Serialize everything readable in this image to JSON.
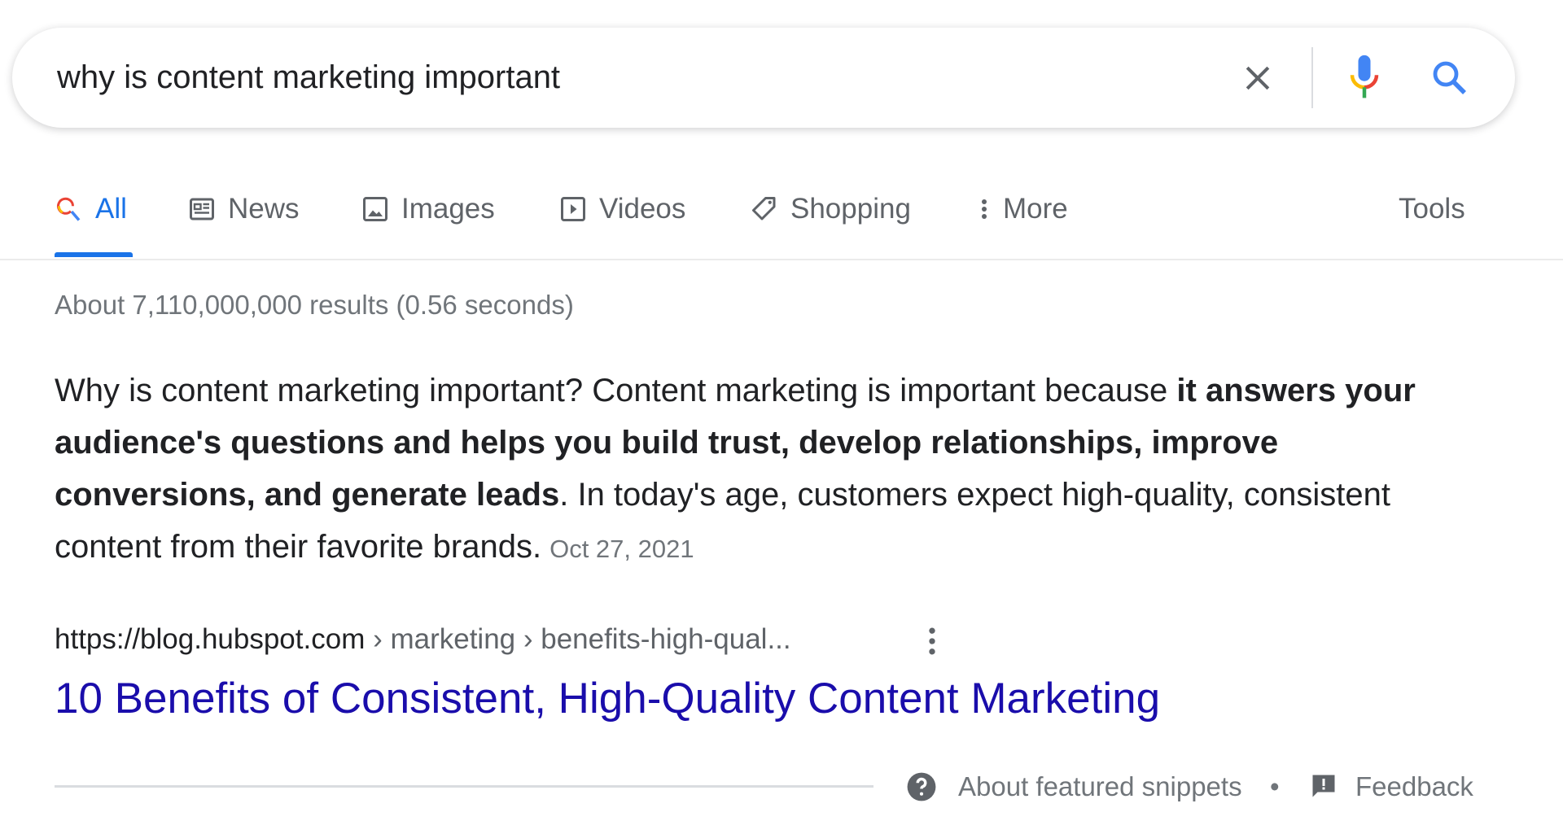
{
  "search": {
    "query": "why is content marketing important"
  },
  "tabs": [
    {
      "label": "All",
      "icon": "search-icon",
      "active": true
    },
    {
      "label": "News",
      "icon": "news-icon"
    },
    {
      "label": "Images",
      "icon": "image-icon"
    },
    {
      "label": "Videos",
      "icon": "video-icon"
    },
    {
      "label": "Shopping",
      "icon": "tag-icon"
    },
    {
      "label": "More",
      "icon": "kebab-icon"
    }
  ],
  "tools_label": "Tools",
  "stats": "About 7,110,000,000 results (0.56 seconds)",
  "snippet": {
    "part1": "Why is content marketing important? Content marketing is important because ",
    "bold": "it answers your audience's questions and helps you build trust, develop relationships, improve conversions, and generate leads",
    "part2": ". In today's age, customers expect high-quality, consistent content from their favorite brands.",
    "date": "Oct 27, 2021"
  },
  "result": {
    "url_host": "https://blog.hubspot.com",
    "url_path": " › marketing › benefits-high-qual...",
    "title": "10 Benefits of Consistent, High-Quality Content Marketing"
  },
  "footer": {
    "about": "About featured snippets",
    "separator": "•",
    "feedback": "Feedback"
  },
  "colors": {
    "accent": "#1a73e8",
    "link": "#1a0dab",
    "muted": "#70757a"
  }
}
